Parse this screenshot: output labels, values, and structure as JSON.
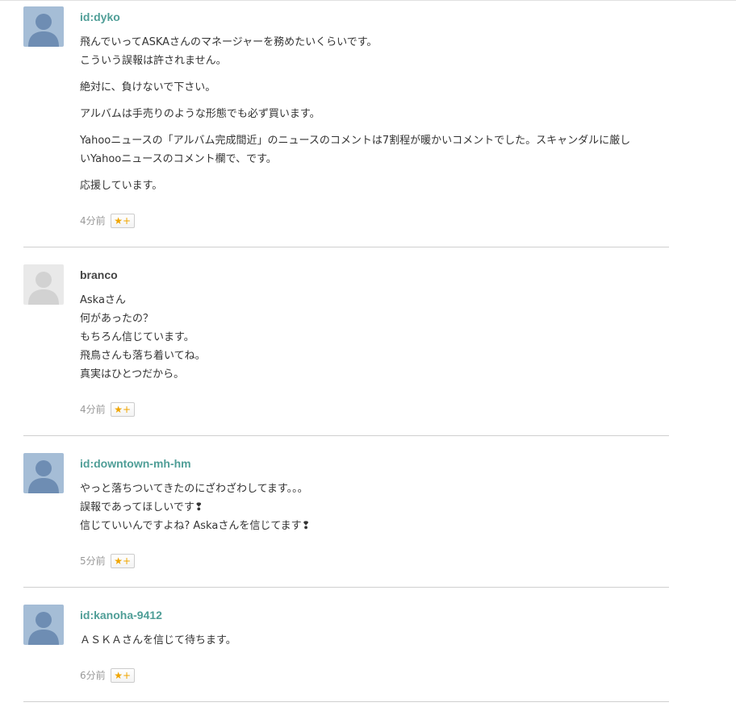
{
  "comments": [
    {
      "username": "id:dyko",
      "avatar_type": "blue-silhouette",
      "paragraphs": [
        [
          "飛んでいってASKAさんのマネージャーを務めたいくらいです。",
          "こういう誤報は許されません。"
        ],
        [
          "絶対に、負けないで下さい。"
        ],
        [
          "アルバムは手売りのような形態でも必ず買います。"
        ],
        [
          "Yahooニュースの「アルバム完成間近」のニュースのコメントは7割程が暖かいコメントでした。スキャンダルに厳し",
          "いYahooニュースのコメント欄で、です。"
        ],
        [
          "応援しています。"
        ]
      ],
      "time": "4分前",
      "star_label": "★+"
    },
    {
      "username": "branco",
      "avatar_type": "gray-silhouette",
      "paragraphs": [
        [
          "Askaさん",
          "何があったの？",
          "もちろん信じています。",
          "飛鳥さんも落ち着いてね。",
          "真実はひとつだから。"
        ]
      ],
      "time": "4分前",
      "star_label": "★+"
    },
    {
      "username": "id:downtown-mh-hm",
      "avatar_type": "blue-silhouette",
      "paragraphs": [
        [
          "やっと落ちついてきたのにざわざわしてます。。。",
          "誤報であってほしいです❢",
          "信じていいんですよね? Askaさんを信じてます❢"
        ]
      ],
      "time": "5分前",
      "star_label": "★+"
    },
    {
      "username": "id:kanoha-9412",
      "avatar_type": "blue-silhouette",
      "paragraphs": [
        [
          "ＡＳＫＡさんを信じて待ちます。"
        ]
      ],
      "time": "6分前",
      "star_label": "★+"
    }
  ],
  "colors": {
    "username_link": "#4f9e97",
    "username_plain": "#444444",
    "star": "#f0a500",
    "divider": "#cfcfcf"
  }
}
